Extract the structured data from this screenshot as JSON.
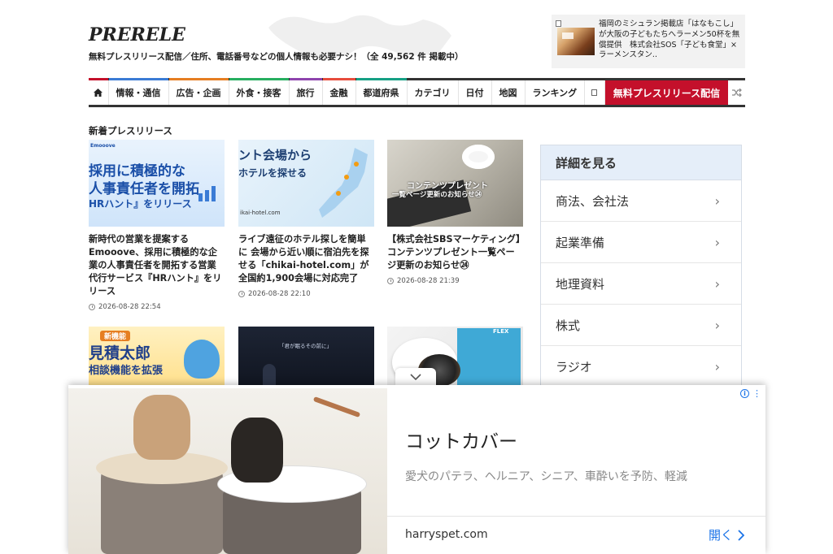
{
  "header": {
    "logo": "PRERELE",
    "tagline": "無料プレスリリース配信／住所、電話番号などの個人情報も必要ナシ！（全 49,562 件 掲載中）",
    "featured_card": {
      "text": "福岡のミシュラン掲載店「はなもこし」が大阪の子どもたちへラーメン50杯を無償提供　株式会社SOS「子ども食堂」×ラーメンスタン.."
    }
  },
  "nav": {
    "items": [
      {
        "label": "情報・通信",
        "color": "#3a7bd5"
      },
      {
        "label": "広告・企画",
        "color": "#e67e22"
      },
      {
        "label": "外食・接客",
        "color": "#27ae60"
      },
      {
        "label": "旅行",
        "color": "#8e44ad"
      },
      {
        "label": "金融",
        "color": "#e74c3c"
      },
      {
        "label": "都道府県",
        "color": "#16a085"
      },
      {
        "label": "カテゴリ",
        "color": "#333333"
      },
      {
        "label": "日付",
        "color": "#333333"
      },
      {
        "label": "地図",
        "color": "#333333"
      },
      {
        "label": "ランキング",
        "color": "#333333"
      }
    ],
    "cta": "無料プレスリリース配信",
    "home_icon": "home-icon",
    "shuffle_icon": "shuffle-icon"
  },
  "main": {
    "section_title": "新着プレスリリース",
    "articles": [
      {
        "title": "新時代の営業を提案する Emooove、採用に積極的な企業の人事責任者を開拓する営業代行サービス『HRハント』をリリース",
        "date": "2026-08-28 22:54",
        "image_text": [
          "採用に積極的な",
          "人事責任者を開拓",
          "HRハント』をリリース"
        ]
      },
      {
        "title": "ライブ遠征のホテル探しを簡単に 会場から近い順に宿泊先を探せる「chikai-hotel.com」が全国約1,900会場に対応完了",
        "date": "2026-08-28 22:10",
        "image_text": [
          "ント会場から",
          "ホテルを探せる",
          "ikai-hotel.com"
        ]
      },
      {
        "title": "【株式会社SBSマーケティング】コンテンツプレゼント一覧ページ更新のお知らせ㉔",
        "date": "2026-08-28 21:39",
        "image_text": [
          "コンテンツプレゼント",
          "一覧ページ更新のお知らせ㉔"
        ]
      },
      {
        "title": "",
        "date": "",
        "image_text": [
          "新機能",
          "見積太郎",
          "相談機能を拡張"
        ]
      },
      {
        "title": "",
        "date": "",
        "image_text": [
          "「君が眠るその前に」"
        ]
      },
      {
        "title": "",
        "date": "",
        "image_text": [
          "FLEX"
        ]
      }
    ]
  },
  "sidebar": {
    "heading": "詳細を見る",
    "items": [
      {
        "label": "商法、会社法"
      },
      {
        "label": "起業準備"
      },
      {
        "label": "地理資料"
      },
      {
        "label": "株式"
      },
      {
        "label": "ラジオ"
      }
    ]
  },
  "ad": {
    "title": "コットカバー",
    "description": "愛犬のパテラ、ヘルニア、シニア、車酔いを予防、軽減",
    "domain": "harryspet.com",
    "open_label": "開く",
    "accent": "#1a73e8"
  }
}
